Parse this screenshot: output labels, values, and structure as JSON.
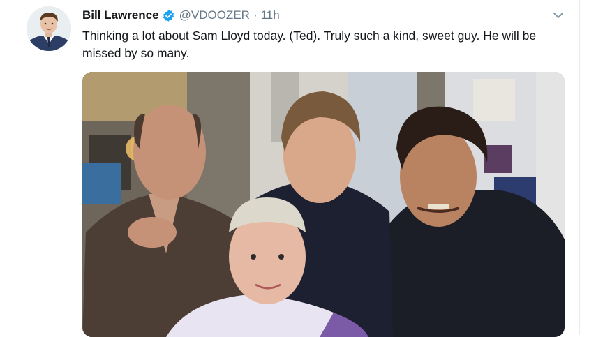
{
  "tweet": {
    "author_name": "Bill Lawrence",
    "handle": "@VDOOZER",
    "separator": "·",
    "time": "11h",
    "text": "Thinking a lot about Sam Lloyd today. (Ted). Truly such a kind, sweet guy. He will be missed by so many."
  },
  "icons": {
    "verified": "verified-badge-icon",
    "menu": "chevron-down-icon"
  },
  "colors": {
    "verified_blue": "#1da1f2",
    "secondary_text": "#657786",
    "primary_text": "#14171a"
  }
}
